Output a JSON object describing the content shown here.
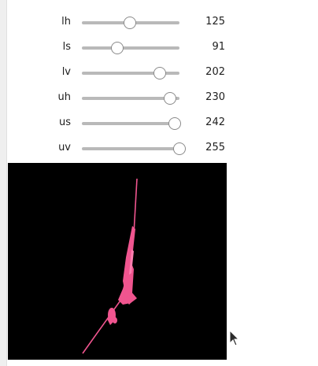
{
  "sliders": [
    {
      "label": "lh",
      "value": "125",
      "fraction": 0.49
    },
    {
      "label": "ls",
      "value": "91",
      "fraction": 0.36
    },
    {
      "label": "lv",
      "value": "202",
      "fraction": 0.8
    },
    {
      "label": "uh",
      "value": "230",
      "fraction": 0.9
    },
    {
      "label": "us",
      "value": "242",
      "fraction": 0.95
    },
    {
      "label": "uv",
      "value": "255",
      "fraction": 1.0
    }
  ],
  "preview": {
    "background": "#000000",
    "mask_color": "#f0558f",
    "mask_highlight": "#ff7eb0"
  },
  "colors": {
    "track": "#b9b9b9",
    "thumb_border": "#8a8a8a",
    "label_text": "#202020"
  },
  "cursor": {
    "icon": "mouse-pointer-icon"
  }
}
